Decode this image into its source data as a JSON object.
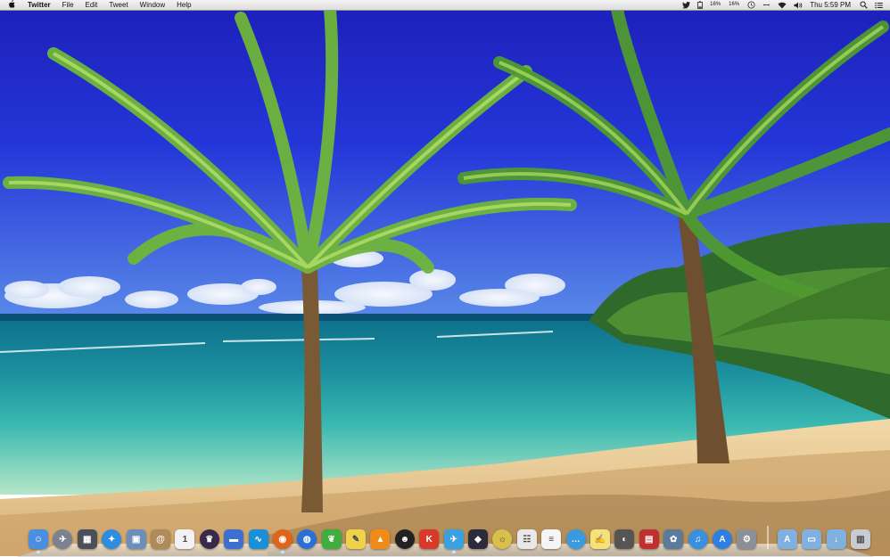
{
  "menubar": {
    "app_name": "Twitter",
    "menus": [
      "File",
      "Edit",
      "Tweet",
      "Window",
      "Help"
    ],
    "status": {
      "battery_1": "16%",
      "battery_2": "16%",
      "clock": "Thu 5:59 PM"
    }
  },
  "dock": {
    "apps": [
      {
        "icon": "finder-icon",
        "color": "#4a8fe0",
        "glyph": "☺",
        "running": true
      },
      {
        "icon": "launchpad-icon",
        "color": "#7b8190",
        "glyph": "✈",
        "round": true
      },
      {
        "icon": "mission-control-icon",
        "color": "#4a4f5a",
        "glyph": "▦"
      },
      {
        "icon": "safari-icon",
        "color": "#2f8de0",
        "glyph": "✦",
        "round": true
      },
      {
        "icon": "preview-icon",
        "color": "#6b8fb8",
        "glyph": "▣"
      },
      {
        "icon": "contacts-icon",
        "color": "#b08a5a",
        "glyph": "@"
      },
      {
        "icon": "calendar-icon",
        "color": "#f2f2f2",
        "glyph": "1"
      },
      {
        "icon": "alfred-icon",
        "color": "#3a2a4a",
        "glyph": "♛",
        "round": true
      },
      {
        "icon": "dropbox-icon",
        "color": "#3d6fd1",
        "glyph": "▬"
      },
      {
        "icon": "waveform-icon",
        "color": "#1a8fd8",
        "glyph": "∿"
      },
      {
        "icon": "firefox-icon",
        "color": "#e0651a",
        "glyph": "◉",
        "round": true,
        "running": true
      },
      {
        "icon": "app-store-alt-icon",
        "color": "#2a6fd6",
        "glyph": "◍",
        "round": true
      },
      {
        "icon": "evernote-icon",
        "color": "#3fae3f",
        "glyph": "❦"
      },
      {
        "icon": "stickies-icon",
        "color": "#f0d24a",
        "glyph": "✎"
      },
      {
        "icon": "vlc-icon",
        "color": "#f08a1a",
        "glyph": "▲"
      },
      {
        "icon": "alien-icon",
        "color": "#222222",
        "glyph": "☻",
        "round": true
      },
      {
        "icon": "klipps-icon",
        "color": "#d83a2a",
        "glyph": "K"
      },
      {
        "icon": "twitter-icon",
        "color": "#3aa0e0",
        "glyph": "✈",
        "running": true
      },
      {
        "icon": "obsidian-icon",
        "color": "#2b2b3a",
        "glyph": "◆"
      },
      {
        "icon": "cyberduck-icon",
        "color": "#d8c04a",
        "glyph": "☼",
        "round": true
      },
      {
        "icon": "dashboard-icon",
        "color": "#e8e8e8",
        "glyph": "☷"
      },
      {
        "icon": "textedit-icon",
        "color": "#f5f5f5",
        "glyph": "≡"
      },
      {
        "icon": "messages-icon",
        "color": "#3a9ae0",
        "glyph": "…",
        "round": true
      },
      {
        "icon": "notes-icon",
        "color": "#f3e27a",
        "glyph": "✍"
      },
      {
        "icon": "facetime-icon",
        "color": "#555555",
        "glyph": "◐"
      },
      {
        "icon": "photo-booth-icon",
        "color": "#c03030",
        "glyph": "▤"
      },
      {
        "icon": "iphoto-icon",
        "color": "#5c7a9a",
        "glyph": "✿"
      },
      {
        "icon": "itunes-icon",
        "color": "#3a8fe0",
        "glyph": "♫",
        "round": true
      },
      {
        "icon": "app-store-icon",
        "color": "#2f7fe0",
        "glyph": "A",
        "round": true
      },
      {
        "icon": "system-preferences-icon",
        "color": "#8a8f98",
        "glyph": "⚙"
      }
    ],
    "stacks": [
      {
        "icon": "applications-folder-icon",
        "color": "#7fb0e0",
        "glyph": "A"
      },
      {
        "icon": "documents-folder-icon",
        "color": "#7fb0e0",
        "glyph": "▭"
      },
      {
        "icon": "downloads-folder-icon",
        "color": "#7fb0e0",
        "glyph": "↓"
      },
      {
        "icon": "trash-icon",
        "color": "#c8ccd2",
        "glyph": "▥"
      }
    ]
  }
}
